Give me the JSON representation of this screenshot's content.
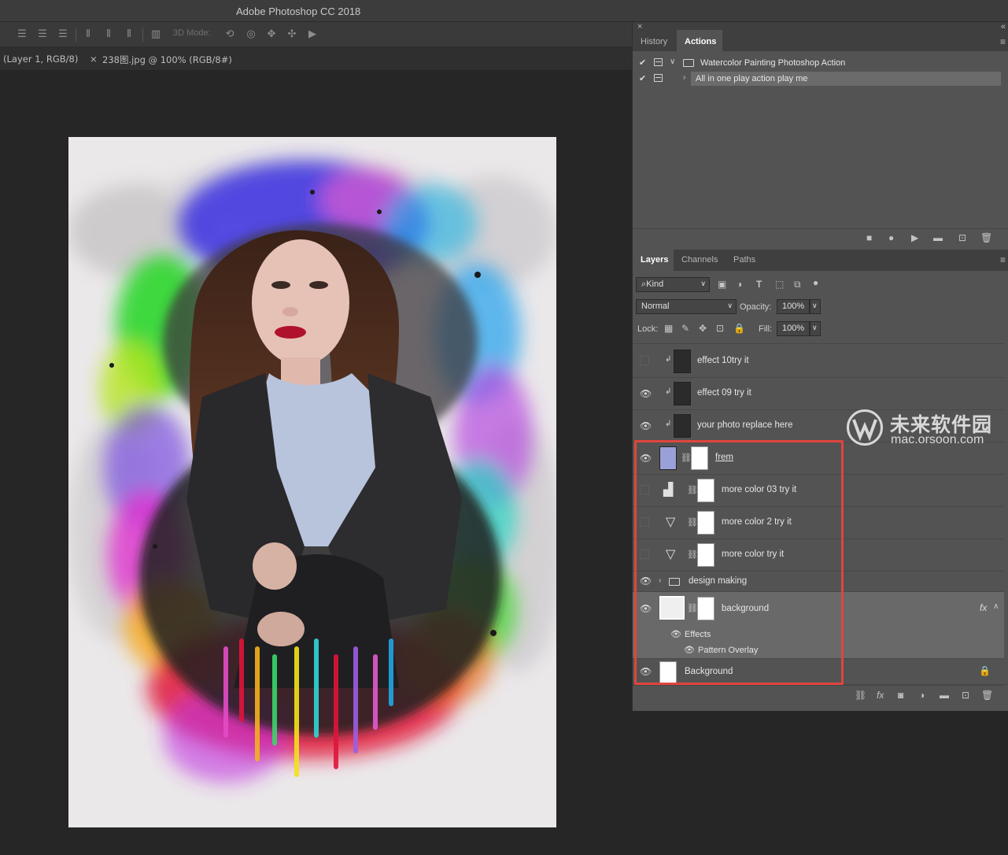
{
  "app": {
    "window_title": "Adobe Photoshop CC 2018"
  },
  "options_bar": {
    "mode_label": "3D Mode:"
  },
  "document_tabs": [
    {
      "label": "(Layer 1, RGB/8)"
    },
    {
      "close": "×",
      "label": "238图.jpg @ 100% (RGB/8#)"
    }
  ],
  "actions_panel": {
    "tabs": [
      "History",
      "Actions"
    ],
    "active_tab": "Actions",
    "close_glyph": "×",
    "collapse_glyph": "«",
    "items": [
      {
        "checked": true,
        "expanded": true,
        "type": "set",
        "label": "Watercolor Painting Photoshop Action"
      },
      {
        "checked": true,
        "expanded": false,
        "type": "action",
        "label": "All in one play action play me"
      }
    ],
    "bottom_buttons": [
      "stop-icon",
      "record-icon",
      "play-icon",
      "folder-icon",
      "new-icon",
      "trash-icon"
    ]
  },
  "layers_panel": {
    "tabs": [
      "Layers",
      "Channels",
      "Paths"
    ],
    "active_tab": "Layers",
    "filter_label": "Kind",
    "blend_mode": "Normal",
    "opacity_label": "Opacity:",
    "opacity_value": "100%",
    "lock_label": "Lock:",
    "fill_label": "Fill:",
    "fill_value": "100%",
    "layers": [
      {
        "name": "effect 10try it",
        "visible": false,
        "clipped": true,
        "type": "pixel"
      },
      {
        "name": "effect 09 try it",
        "visible": true,
        "clipped": true,
        "type": "pixel"
      },
      {
        "name": "your photo replace here",
        "visible": true,
        "clipped": true,
        "type": "pixel"
      },
      {
        "name": "frem",
        "visible": true,
        "type": "masked"
      },
      {
        "name": "more color 03 try it",
        "visible": false,
        "type": "levels-adjustment"
      },
      {
        "name": "more color 2 try it",
        "visible": false,
        "type": "gradient-adjustment"
      },
      {
        "name": "more color try it",
        "visible": false,
        "type": "gradient-adjustment"
      },
      {
        "name": "design making",
        "visible": true,
        "type": "group"
      },
      {
        "name": "background",
        "visible": true,
        "type": "masked",
        "selected": true,
        "fx": "fx"
      },
      {
        "name": "Background",
        "visible": true,
        "type": "background",
        "locked": true
      }
    ],
    "effects_label": "Effects",
    "effect_items": [
      "Pattern Overlay"
    ],
    "bottom_buttons": [
      "link-icon",
      "fx-icon",
      "mask-icon",
      "adjustment-icon",
      "group-folder-icon",
      "new-layer-icon",
      "trash-icon"
    ]
  },
  "watermark": {
    "cn_text": "未来软件园",
    "en_text": "mac.orsoon.com"
  },
  "colors": {
    "panel_bg": "#535353",
    "highlight": "#e0453d",
    "canvas_bg": "#262626"
  }
}
